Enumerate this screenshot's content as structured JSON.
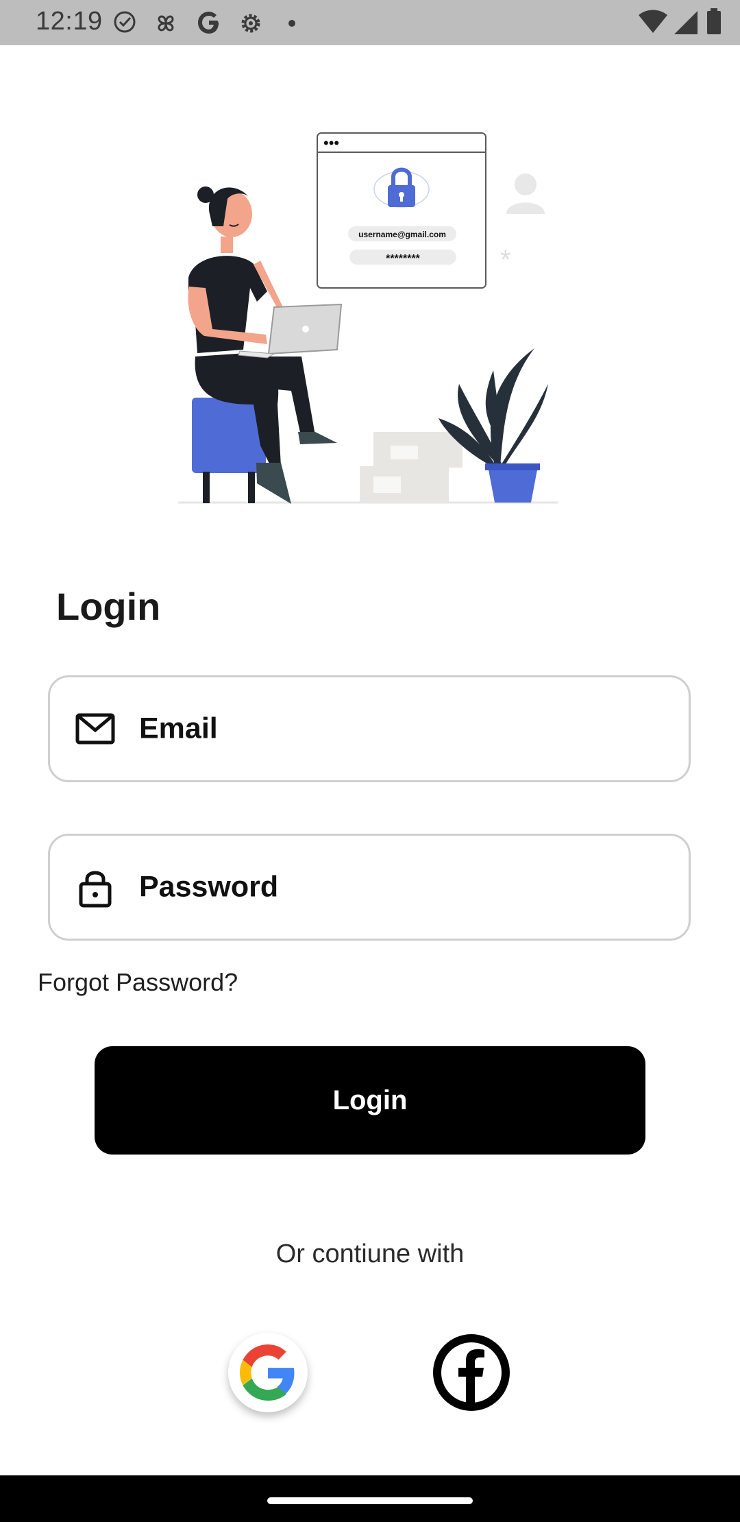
{
  "status_bar": {
    "time": "12:19",
    "left_icons": [
      "check-circle-icon",
      "pinwheel-icon",
      "google-icon",
      "settings-gear-icon",
      "dot-icon"
    ],
    "right_icons": [
      "wifi-icon",
      "cellular-signal-icon",
      "battery-icon"
    ]
  },
  "hero": {
    "email_text": "username@gmail.com",
    "password_text": "********",
    "window_dots": "•••"
  },
  "login": {
    "title": "Login",
    "email_label": "Email",
    "password_label": "Password",
    "forgot_password": "Forgot Password?",
    "login_button": "Login",
    "or_continue": "Or contiune with"
  },
  "social": {
    "google": "google-icon",
    "facebook": "facebook-icon"
  },
  "colors": {
    "accent_blue": "#4f6bd6",
    "dark": "#1c1f26",
    "skin": "#f2a58a",
    "button": "#000000"
  }
}
